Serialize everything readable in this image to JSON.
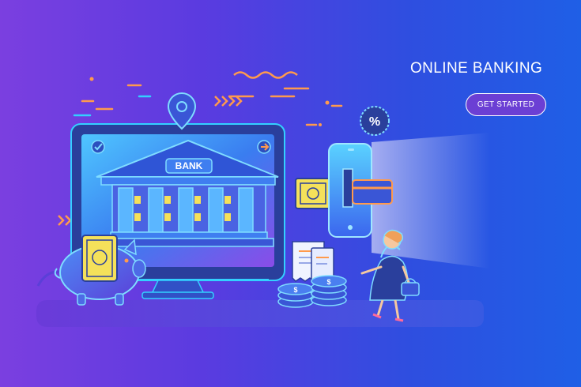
{
  "hero": {
    "title": "ONLINE BANKING",
    "cta_label": "GET STARTED"
  },
  "illustration": {
    "bank_sign": "BANK",
    "percent_badge": "%",
    "coin_symbol": "$"
  },
  "colors": {
    "background_start": "#7b3fe0",
    "background_end": "#1f5fe6",
    "accent_orange": "#ff9a4d",
    "accent_cyan": "#33d0ff",
    "accent_yellow": "#f5e15a"
  }
}
